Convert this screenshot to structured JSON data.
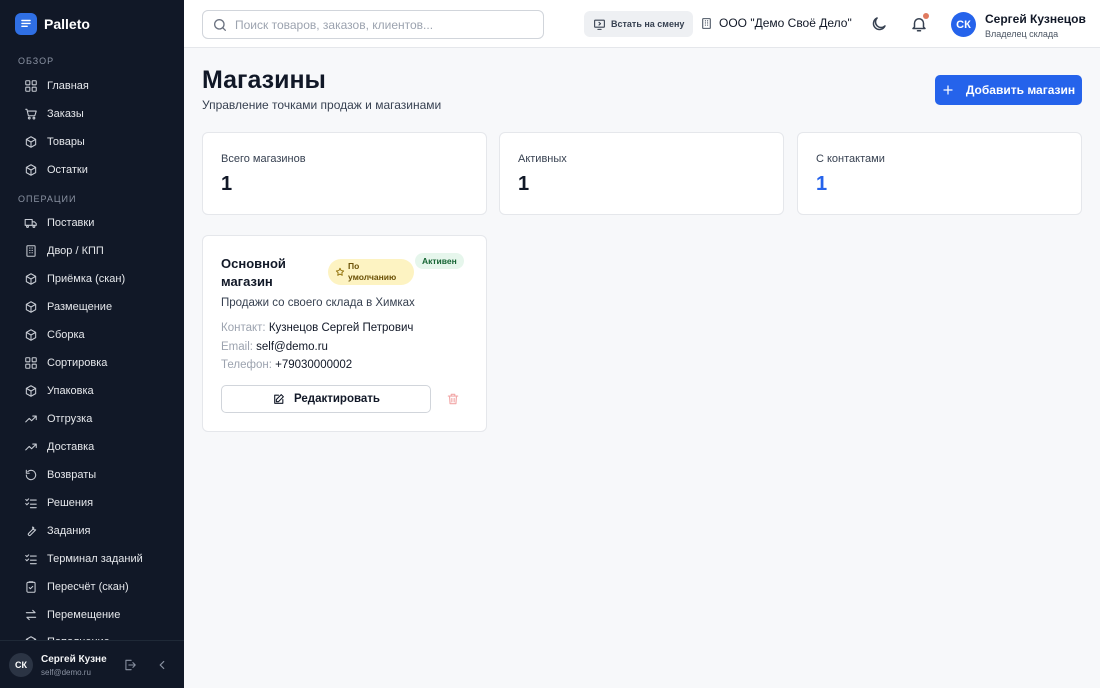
{
  "brand": {
    "name": "Palleto",
    "icon": "list-doc-icon"
  },
  "sidebar": {
    "section_overview": "Обзор",
    "overview_items": [
      {
        "label": "Главная",
        "icon": "grid-icon"
      },
      {
        "label": "Заказы",
        "icon": "cart-icon"
      },
      {
        "label": "Товары",
        "icon": "box-icon"
      },
      {
        "label": "Остатки",
        "icon": "box-icon"
      }
    ],
    "section_operations": "Операции",
    "operations_items": [
      {
        "label": "Поставки",
        "icon": "truck-icon"
      },
      {
        "label": "Двор / КПП",
        "icon": "building-icon"
      },
      {
        "label": "Приёмка (скан)",
        "icon": "box-icon"
      },
      {
        "label": "Размещение",
        "icon": "box-icon"
      },
      {
        "label": "Сборка",
        "icon": "box-icon"
      },
      {
        "label": "Сортировка",
        "icon": "grid-icon"
      },
      {
        "label": "Упаковка",
        "icon": "box-icon"
      },
      {
        "label": "Отгрузка",
        "icon": "trend-icon"
      },
      {
        "label": "Доставка",
        "icon": "trend-icon"
      },
      {
        "label": "Возвраты",
        "icon": "refresh-icon"
      },
      {
        "label": "Решения",
        "icon": "list-check-icon"
      },
      {
        "label": "Задания",
        "icon": "wrench-icon"
      },
      {
        "label": "Терминал заданий",
        "icon": "list-check-icon"
      },
      {
        "label": "Пересчёт (скан)",
        "icon": "clipboard-icon"
      },
      {
        "label": "Перемещение",
        "icon": "arrows-icon"
      },
      {
        "label": "Пополнение",
        "icon": "box-icon"
      }
    ],
    "user": {
      "initials": "СК",
      "name": "Сергей Кузнецов",
      "email": "self@demo.ru"
    }
  },
  "header": {
    "search_placeholder": "Поиск товаров, заказов, клиентов...",
    "shift_button": "Встать на смену",
    "org_name": "ООО \"Демо Своё Дело\"",
    "user": {
      "initials": "СК",
      "name": "Сергей Кузнецов",
      "role": "Владелец склада"
    }
  },
  "main": {
    "title": "Магазины",
    "subtitle": "Управление точками продаж и магазинами",
    "add_button": "Добавить магазин",
    "stats": [
      {
        "label": "Всего магазинов",
        "value": "1"
      },
      {
        "label": "Активных",
        "value": "1"
      },
      {
        "label": "С контактами",
        "value": "1"
      }
    ],
    "store": {
      "name": "Основной магазин",
      "badge_default": "По умолчанию",
      "badge_status": "Активен",
      "description": "Продажи со своего склада в Химках",
      "contact_label": "Контакт:",
      "contact_value": "Кузнецов Сергей Петрович",
      "email_label": "Email:",
      "email_value": "self@demo.ru",
      "phone_label": "Телефон:",
      "phone_value": "+79030000002",
      "edit_button": "Редактировать"
    }
  },
  "colors": {
    "accent": "#2563eb",
    "sidebar_bg": "#111827",
    "status_active_bg": "#e6f6ec",
    "default_badge_bg": "#fdf3c2"
  }
}
